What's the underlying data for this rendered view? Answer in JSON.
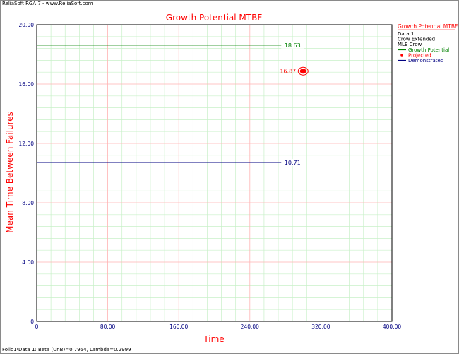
{
  "window": {
    "header": "ReliaSoft RGA 7 - www.ReliaSoft.com",
    "footer": "Folio1\\Data 1: Beta (UnB)=0.7954, Lambda=0.2999"
  },
  "legend": {
    "title": "Growth Potential MTBF",
    "info": [
      "Data 1",
      "Crow Extended",
      "MLE Crow"
    ],
    "entries": [
      {
        "label": "Growth Potential",
        "color": "#008000",
        "marker": "line"
      },
      {
        "label": "Projected",
        "color": "#ff0000",
        "marker": "dot"
      },
      {
        "label": "Demonstrated",
        "color": "#000080",
        "marker": "line"
      }
    ]
  },
  "chart_data": {
    "type": "line",
    "title": "Growth Potential MTBF",
    "xlabel": "Time",
    "ylabel": "Mean Time Between Failures",
    "xlim": [
      0,
      400
    ],
    "ylim": [
      0,
      20
    ],
    "x_ticks": [
      "0",
      "80.00",
      "160.00",
      "240.00",
      "320.00",
      "400.00"
    ],
    "y_ticks": [
      "0",
      "4.00",
      "8.00",
      "12.00",
      "16.00",
      "20.00"
    ],
    "x_tick_values": [
      0,
      80,
      160,
      240,
      320,
      400
    ],
    "y_tick_values": [
      0,
      4,
      8,
      12,
      16,
      20
    ],
    "grid": true,
    "series": [
      {
        "name": "Growth Potential",
        "type": "hline",
        "x": [
          0,
          300
        ],
        "y": 18.63,
        "label": "18.63",
        "color": "#008000"
      },
      {
        "name": "Projected",
        "type": "point",
        "x": 300,
        "y": 16.87,
        "label": "16.87",
        "color": "#ff0000"
      },
      {
        "name": "Demonstrated",
        "type": "hline",
        "x": [
          0,
          300
        ],
        "y": 10.71,
        "label": "10.71",
        "color": "#000080"
      }
    ],
    "colors": {
      "axis_title": "#ff0000",
      "tick_label": "#000080",
      "major_grid": "#ffb3b3",
      "minor_grid": "#c8f0c8"
    }
  }
}
